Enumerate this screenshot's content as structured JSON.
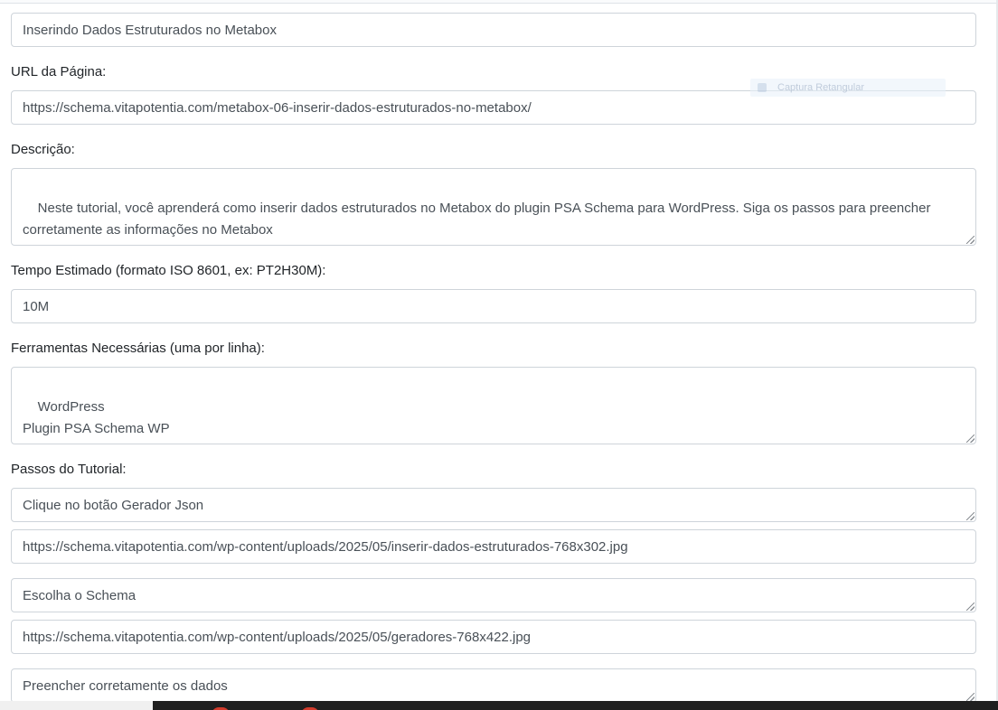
{
  "form": {
    "title_value": "Inserindo Dados Estruturados no Metabox",
    "url": {
      "label": "URL da Página:",
      "value": "https://schema.vitapotentia.com/metabox-06-inserir-dados-estruturados-no-metabox/"
    },
    "description": {
      "label": "Descrição:",
      "value": "Neste tutorial, você aprenderá como inserir dados estruturados no Metabox do plugin PSA Schema para WordPress. Siga os passos para preencher corretamente as informações no Metabox"
    },
    "time": {
      "label": "Tempo Estimado (formato ISO 8601, ex: PT2H30M):",
      "value": "10M"
    },
    "tools": {
      "label": "Ferramentas Necessárias (uma por linha):",
      "value": "WordPress\nPlugin PSA Schema WP"
    },
    "steps": {
      "label": "Passos do Tutorial:",
      "items": [
        {
          "text": "Clique no botão Gerador Json",
          "image": "https://schema.vitapotentia.com/wp-content/uploads/2025/05/inserir-dados-estruturados-768x302.jpg"
        },
        {
          "text": "Escolha o Schema",
          "image": "https://schema.vitapotentia.com/wp-content/uploads/2025/05/geradores-768x422.jpg"
        },
        {
          "text": "Preencher corretamente os dados"
        }
      ]
    }
  },
  "overlay": {
    "tooltip_text": "Captura Retangular"
  },
  "colors": {
    "border": "#ced4da",
    "text": "#495057",
    "taskbar": "#1f1f1f"
  }
}
